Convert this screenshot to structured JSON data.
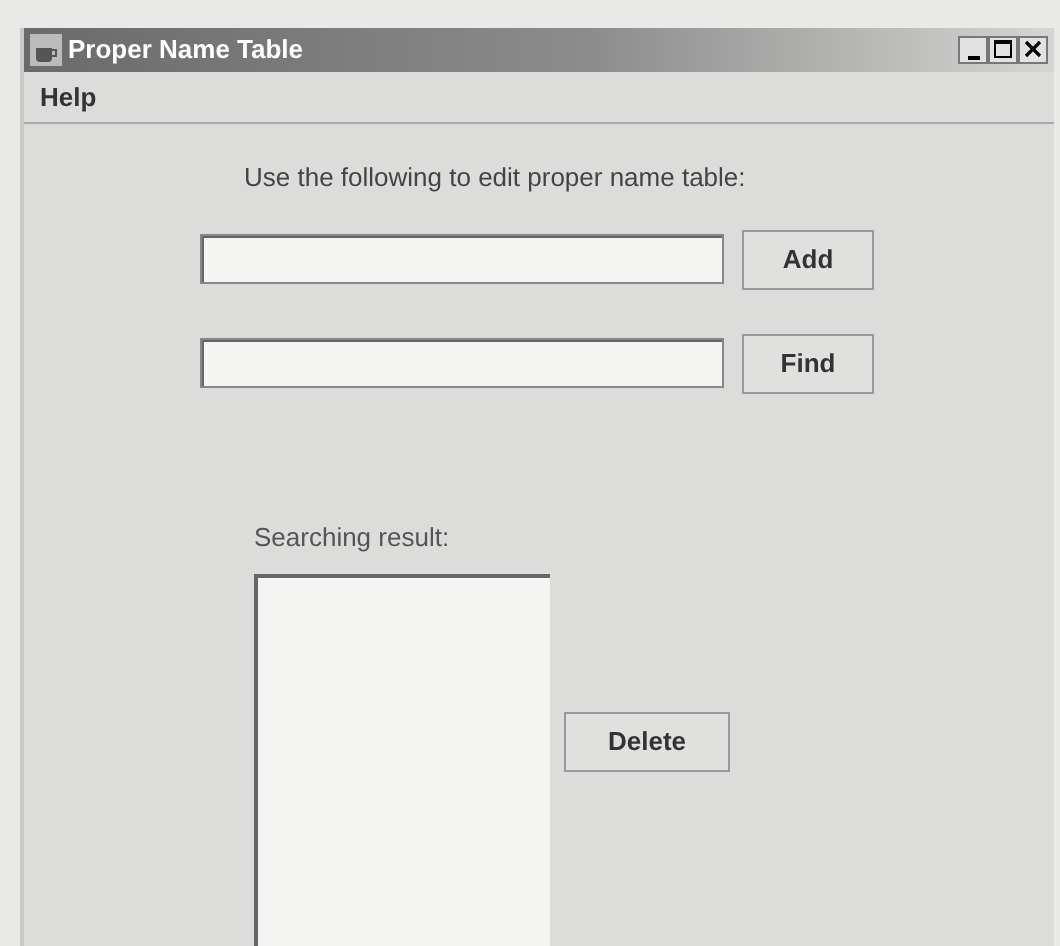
{
  "window": {
    "title": "Proper Name Table"
  },
  "menu": [
    "Help"
  ],
  "instruction": "Use the following to edit proper name table:",
  "rows": [
    {
      "button": "Add"
    },
    {
      "button": "Find"
    }
  ],
  "result_label": "Searching result:",
  "delete_button": "Delete"
}
